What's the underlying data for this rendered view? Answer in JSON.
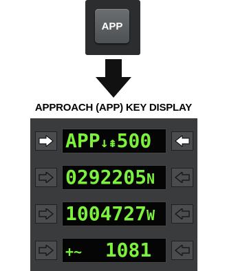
{
  "app_key": {
    "label": "APP"
  },
  "title": "APPROACH (APP) KEY DISPLAY",
  "display": {
    "rows": [
      {
        "prefix": "APP",
        "symbols": "↓⇞",
        "value": "500",
        "left_active": true,
        "right_active": true
      },
      {
        "main": "0292205",
        "suffix": "N",
        "left_active": false,
        "right_active": false
      },
      {
        "main": "1004727",
        "suffix": "W",
        "left_active": false,
        "right_active": false
      },
      {
        "prefix": "+~",
        "value": "1081",
        "left_active": false,
        "right_active": false
      }
    ]
  },
  "colors": {
    "lcd_green": "#7cf23c",
    "arrow_active": "#ffffff",
    "arrow_inactive": "#1a1a1a"
  },
  "icons": [
    "white-arrow-right-icon",
    "white-arrow-left-icon",
    "outline-arrow-right-icon",
    "outline-arrow-left-icon",
    "down-arrow-icon"
  ]
}
